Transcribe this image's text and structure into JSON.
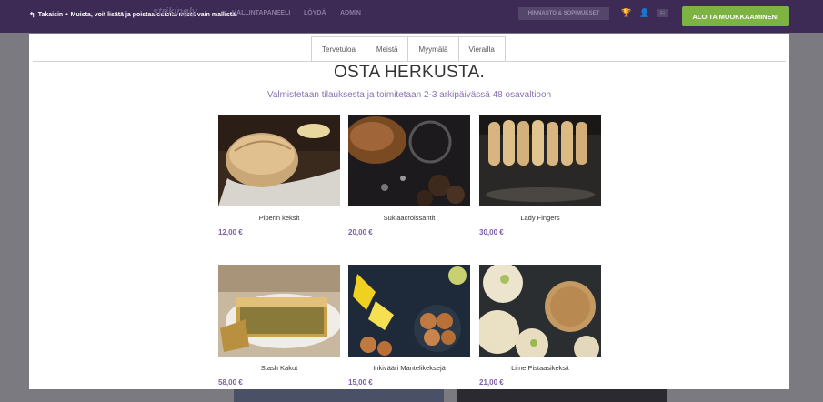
{
  "topbar": {
    "back_label": "Takaisin",
    "separator": "•",
    "notice": "Muista, voit lisätä ja poistaa osioita mistä vain mallista.",
    "logo_text": "strikingly",
    "nav": [
      "HALLINTAPANEELI",
      "LÖYDÄ",
      "ADMIN"
    ],
    "pricing_label": "HINNASTO & SOPIMUKSET",
    "lang": "FI",
    "start_button": "ALOITA MUOKKAAMINEN!",
    "start_color": "#7cb342",
    "bar_color": "#3d2a55"
  },
  "modal": {
    "tabs": [
      "Tervetuloa",
      "Meistä",
      "Myymälä",
      "Vierailla"
    ],
    "title": "OSTA HERKUSTA.",
    "subtitle": "Valmistetaan tilauksesta ja toimitetaan 2-3 arkipäivässä 48 osavaltioon",
    "accent_color": "#7b5ea7"
  },
  "products": [
    {
      "name": "Piperin keksit",
      "price": "12,00 €",
      "image": "bread-loaf-image"
    },
    {
      "name": "Suklaacroissantit",
      "price": "20,00 €",
      "image": "chocolate-croissant-image"
    },
    {
      "name": "Lady Fingers",
      "price": "30,00 €",
      "image": "lady-fingers-image"
    },
    {
      "name": "Stash Kakut",
      "price": "58,00 €",
      "image": "quiche-image"
    },
    {
      "name": "Inkivääri Mantelikeksejä",
      "price": "15,00 €",
      "image": "almond-cookies-image"
    },
    {
      "name": "Lime Pistaasikeksit",
      "price": "21,00 €",
      "image": "pistachio-cookies-image"
    }
  ]
}
